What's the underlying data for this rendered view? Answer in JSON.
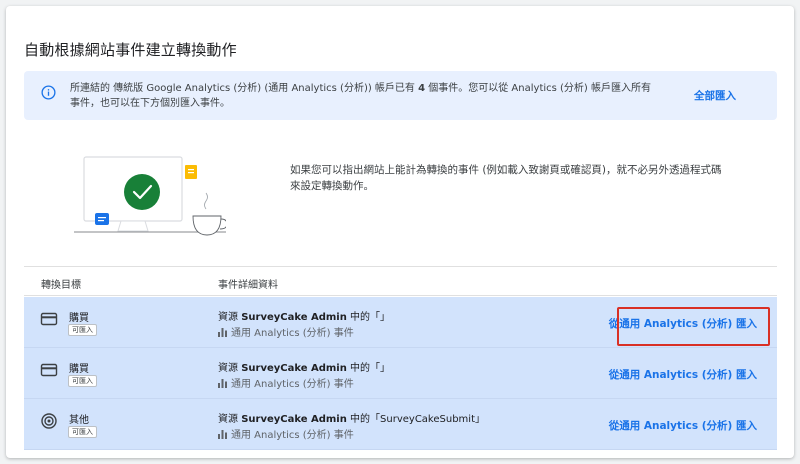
{
  "page": {
    "title": "自動根據網站事件建立轉換動作"
  },
  "banner": {
    "text_before": "所連結的 傳統版 Google Analytics (分析) (通用 Analytics (分析)) 帳戶已有 ",
    "count": "4",
    "text_after": " 個事件。您可以從 Analytics (分析) 帳戶匯入所有事件，也可以在下方個別匯入事件。",
    "import_all_label": "全部匯入"
  },
  "intro": {
    "description": "如果您可以指出網站上能計為轉換的事件 (例如載入致謝頁或確認頁)，就不必另外透過程式碼來設定轉換動作。"
  },
  "table": {
    "headers": {
      "goal": "轉換目標",
      "detail": "事件詳細資料"
    },
    "rows": [
      {
        "icon": "credit-card-icon",
        "goal": "購買",
        "badge": "可匯入",
        "detail_prefix": "資源 ",
        "detail_source": "SurveyCake Admin",
        "detail_suffix": " 中的「」",
        "detail_sub": "通用 Analytics (分析) 事件",
        "action": "從通用 Analytics (分析) 匯入",
        "highlighted": true
      },
      {
        "icon": "credit-card-icon",
        "goal": "購買",
        "badge": "可匯入",
        "detail_prefix": "資源 ",
        "detail_source": "SurveyCake Admin",
        "detail_suffix": " 中的「」",
        "detail_sub": "通用 Analytics (分析) 事件",
        "action": "從通用 Analytics (分析) 匯入",
        "highlighted": false
      },
      {
        "icon": "target-icon",
        "goal": "其他",
        "badge": "可匯入",
        "detail_prefix": "資源 ",
        "detail_source": "SurveyCake Admin",
        "detail_suffix": " 中的「SurveyCakeSubmit」",
        "detail_sub": "通用 Analytics (分析) 事件",
        "action": "從通用 Analytics (分析) 匯入",
        "highlighted": false
      }
    ]
  },
  "colors": {
    "accent": "#1a73e8",
    "banner_bg": "#e8f0fe",
    "row_bg": "#d2e3fc",
    "highlight": "#d93025",
    "check_green": "#188038"
  }
}
